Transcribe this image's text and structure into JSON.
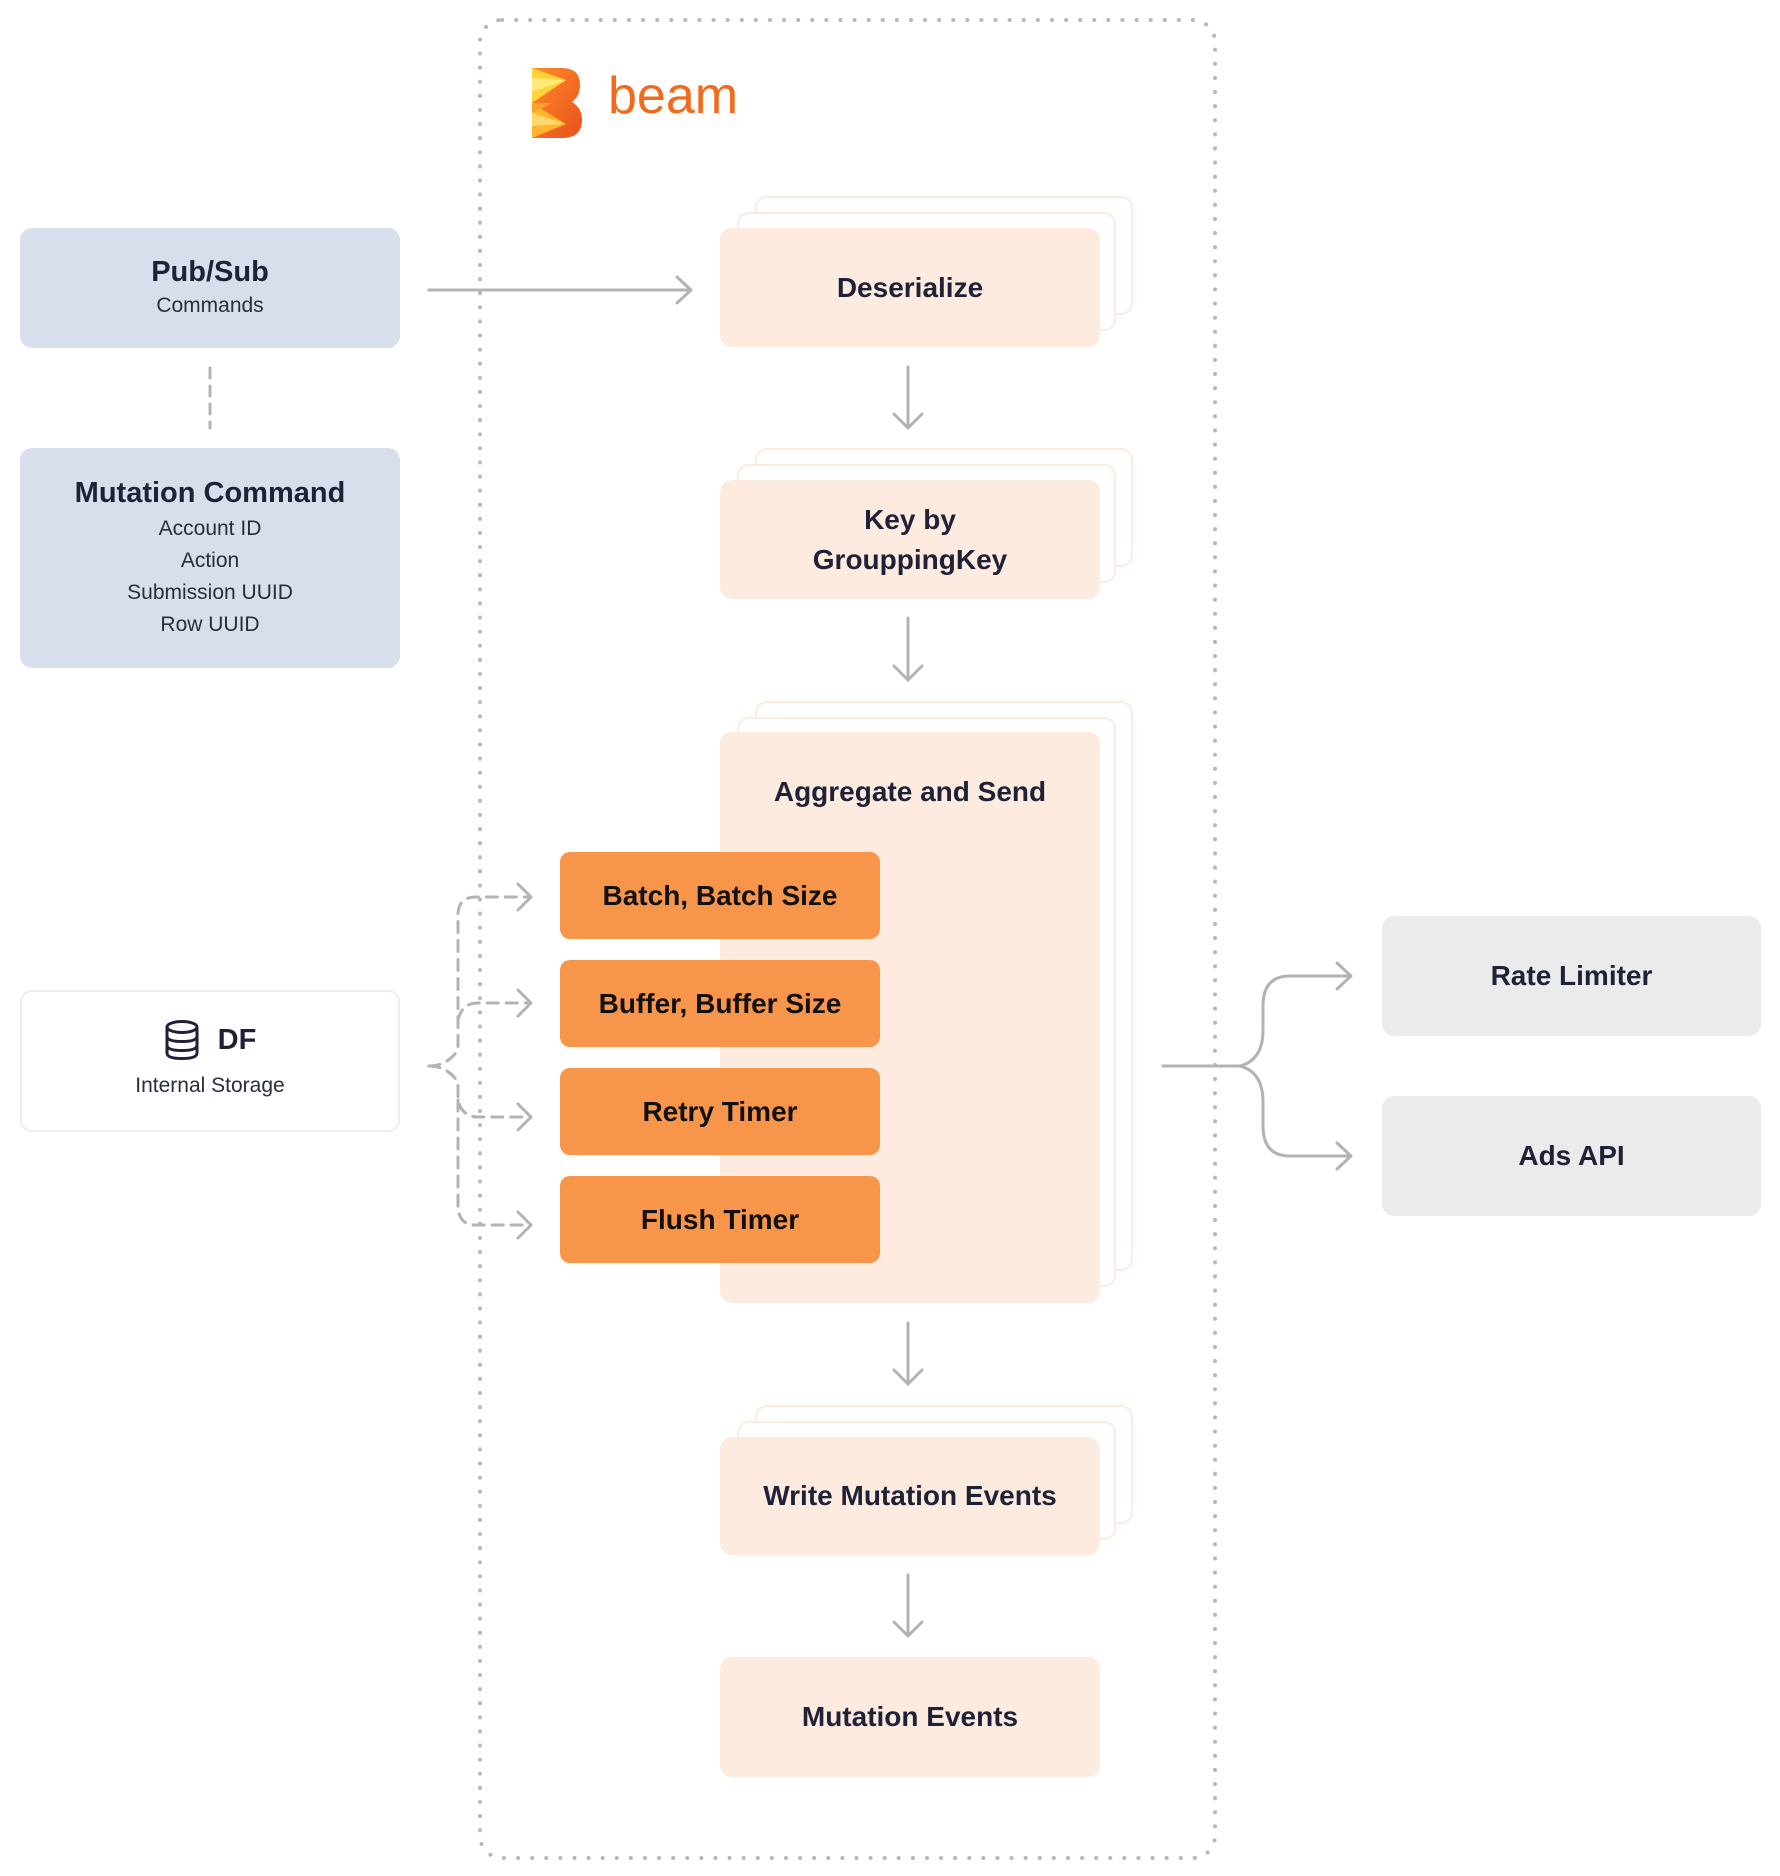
{
  "pipeline": {
    "brand": {
      "name": "beam",
      "logo_icon": "apache-beam-logo-icon",
      "colors": {
        "brand_orange": "#F26B1D",
        "logo_yellow": "#FFD23A"
      }
    },
    "stages": [
      {
        "label": "Deserialize",
        "stacked": true
      },
      {
        "label_lines": [
          "Key by",
          "GrouppingKey"
        ],
        "stacked": true
      },
      {
        "label": "Aggregate and Send",
        "stacked": true
      },
      {
        "label": "Write Mutation Events",
        "stacked": true
      },
      {
        "label": "Mutation Events",
        "stacked": false
      }
    ],
    "aggregate_params": [
      {
        "label": "Batch, Batch Size"
      },
      {
        "label": "Buffer, Buffer Size"
      },
      {
        "label": "Retry Timer"
      },
      {
        "label": "Flush Timer"
      }
    ]
  },
  "sources": {
    "pubsub": {
      "title": "Pub/Sub",
      "subtitle": "Commands"
    },
    "mutation_command": {
      "title": "Mutation Command",
      "fields": [
        "Account ID",
        "Action",
        "Submission UUID",
        "Row UUID"
      ]
    },
    "storage": {
      "icon": "database-icon",
      "title": "DF",
      "subtitle": "Internal Storage"
    }
  },
  "sinks": [
    {
      "label": "Rate Limiter"
    },
    {
      "label": "Ads API"
    }
  ],
  "colors": {
    "source_bg": "#D8DEEC",
    "stage_bg": "#FDEBE0",
    "param_bg": "#F7954A",
    "sink_bg": "#EBEBEB",
    "connector": "#B3B3B3",
    "text": "#1F2237"
  }
}
